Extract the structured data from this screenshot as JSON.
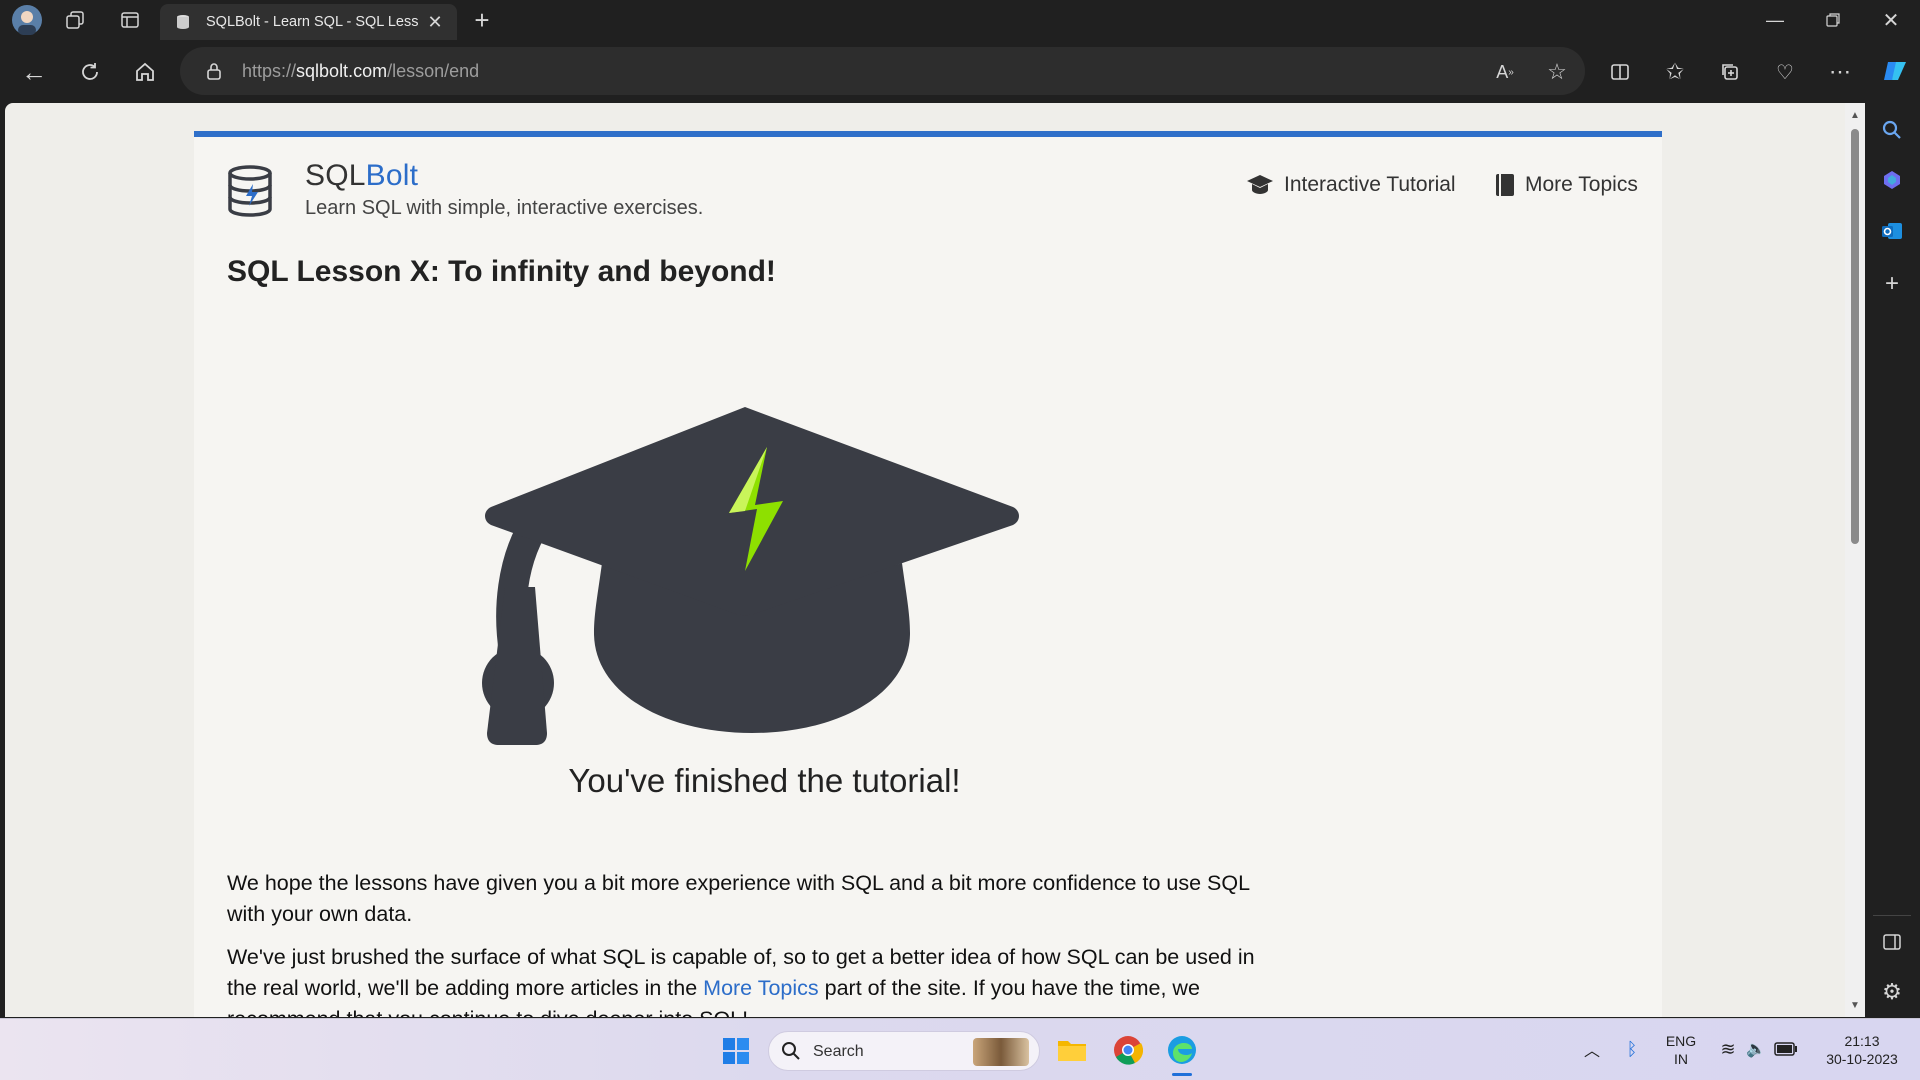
{
  "browser": {
    "tab_title": "SQLBolt - Learn SQL - SQL Lesson",
    "url_prefix": "https://",
    "url_host": "sqlbolt.com",
    "url_path": "/lesson/end"
  },
  "site": {
    "brand_sql": "SQL",
    "brand_bolt": "Bolt",
    "tagline": "Learn SQL with simple, interactive exercises.",
    "nav": [
      "Interactive Tutorial",
      "More Topics"
    ]
  },
  "lesson": {
    "title": "SQL Lesson X: To infinity and beyond!",
    "finished": "You've finished the tutorial!",
    "para1": "We hope the lessons have given you a bit more experience with SQL and a bit more confidence to use SQL with your own data.",
    "para2_before": "We've just brushed the surface of what SQL is capable of, so to get a better idea of how SQL can be used in the real world, we'll be adding more articles in the ",
    "para2_link": "More Topics",
    "para2_after": " part of the site. If you have the time, we recommend that you continue to dive deeper into SQL!"
  },
  "taskbar": {
    "search_placeholder": "Search",
    "lang_top": "ENG",
    "lang_bottom": "IN",
    "time": "21:13",
    "date": "30-10-2023"
  },
  "colors": {
    "accent": "#2c6dc9",
    "bolt_green": "#8ee000",
    "cap": "#3a3d45"
  }
}
